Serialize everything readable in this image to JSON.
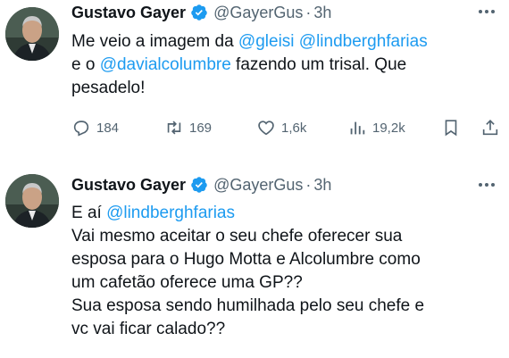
{
  "colors": {
    "text": "#0f1419",
    "secondary": "#536471",
    "accent": "#1d9bf0",
    "verified": "#1d9bf0"
  },
  "tweets": [
    {
      "author": {
        "name": "Gustavo Gayer",
        "handle": "@GayerGus",
        "separator": "·",
        "time": "3h",
        "verified_icon": "verified-badge-icon",
        "avatar": "avatar"
      },
      "body": {
        "line1": {
          "text1": "Me veio a imagem da ",
          "mention1": "@gleisi",
          "space": " ",
          "mention2": "@lindberghfarias"
        },
        "line2": {
          "text1": "e o ",
          "mention1": "@davialcolumbre",
          "text2": " fazendo um trisal. Que"
        },
        "line3": {
          "text1": "pesadelo!"
        }
      },
      "actions": {
        "reply_count": "184",
        "retweet_count": "169",
        "like_count": "1,6k",
        "views_count": "19,2k",
        "icons": [
          "reply-icon",
          "retweet-icon",
          "like-icon",
          "views-icon",
          "bookmark-icon",
          "share-icon"
        ]
      }
    },
    {
      "author": {
        "name": "Gustavo Gayer",
        "handle": "@GayerGus",
        "separator": "·",
        "time": "3h",
        "verified_icon": "verified-badge-icon",
        "avatar": "avatar"
      },
      "body": {
        "line1": {
          "text1": "E aí ",
          "mention1": "@lindberghfarias"
        },
        "line2": {
          "text1": "Vai mesmo aceitar o seu chefe oferecer sua"
        },
        "line3": {
          "text1": "esposa para o Hugo Motta e Alcolumbre como"
        },
        "line4": {
          "text1": "um cafetão oferece uma GP??"
        },
        "line5": {
          "text1": "Sua esposa sendo humilhada pelo seu chefe e"
        },
        "line6": {
          "text1": "vc vai ficar calado??"
        }
      }
    }
  ]
}
